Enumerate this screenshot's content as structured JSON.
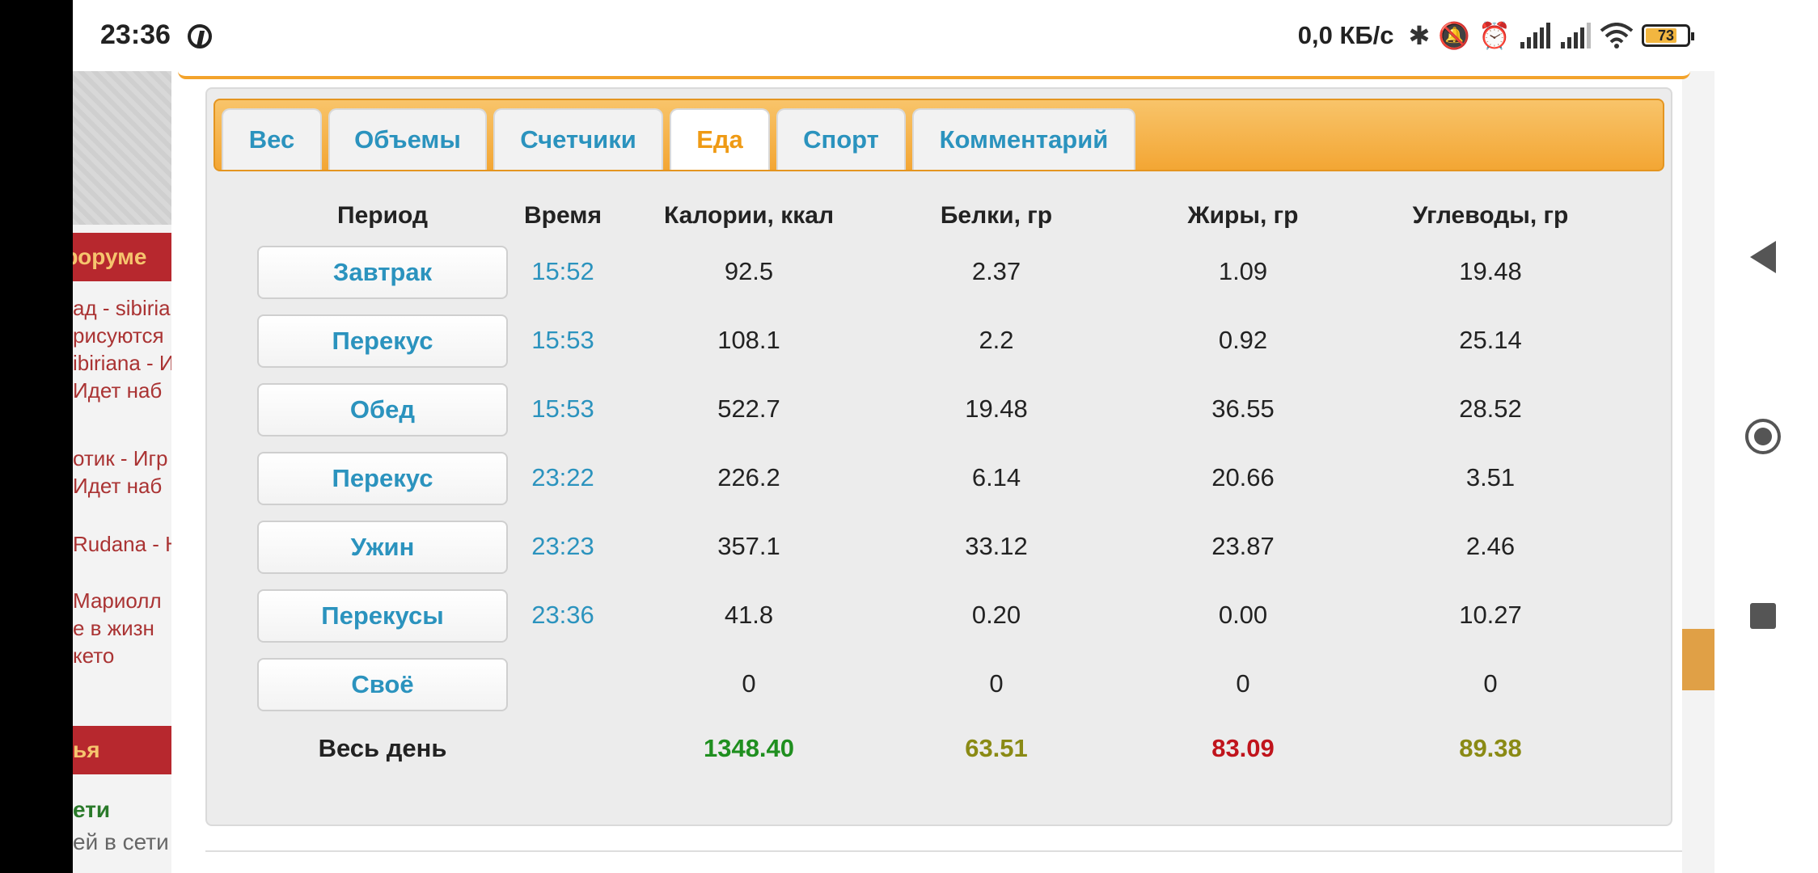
{
  "status": {
    "time": "23:36",
    "net_speed": "0,0 КБ/с",
    "battery": "73",
    "icons": [
      "pinterest-icon",
      "bluetooth-icon",
      "bell-off-icon",
      "alarm-icon",
      "signal-icon",
      "signal-icon",
      "wifi-icon",
      "battery-icon"
    ]
  },
  "background": {
    "forum_header": "форуме",
    "forum_lines": [
      "ад - sibiria",
      "рисуются",
      "ibiriana - И",
      "Идет наб",
      "отик - Игр",
      "Идет наб",
      "Rudana - Н",
      "Мариолл",
      "е в жизн",
      "кето"
    ],
    "section2_header": "ья",
    "online_label": "ети",
    "online_text": "ей в сети"
  },
  "tabs": [
    "Вес",
    "Объемы",
    "Счетчики",
    "Еда",
    "Спорт",
    "Комментарий"
  ],
  "active_tab": "Еда",
  "table": {
    "headers": [
      "Период",
      "Время",
      "Калории, ккал",
      "Белки, гр",
      "Жиры, гр",
      "Углеводы, гр"
    ],
    "rows": [
      {
        "period": "Завтрак",
        "time": "15:52",
        "kcal": "92.5",
        "protein": "2.37",
        "fat": "1.09",
        "carbs": "19.48"
      },
      {
        "period": "Перекус",
        "time": "15:53",
        "kcal": "108.1",
        "protein": "2.2",
        "fat": "0.92",
        "carbs": "25.14"
      },
      {
        "period": "Обед",
        "time": "15:53",
        "kcal": "522.7",
        "protein": "19.48",
        "fat": "36.55",
        "carbs": "28.52"
      },
      {
        "period": "Перекус",
        "time": "23:22",
        "kcal": "226.2",
        "protein": "6.14",
        "fat": "20.66",
        "carbs": "3.51"
      },
      {
        "period": "Ужин",
        "time": "23:23",
        "kcal": "357.1",
        "protein": "33.12",
        "fat": "23.87",
        "carbs": "2.46"
      },
      {
        "period": "Перекусы",
        "time": "23:36",
        "kcal": "41.8",
        "protein": "0.20",
        "fat": "0.00",
        "carbs": "10.27"
      },
      {
        "period": "Своё",
        "time": "",
        "kcal": "0",
        "protein": "0",
        "fat": "0",
        "carbs": "0"
      }
    ],
    "total": {
      "label": "Весь день",
      "kcal": "1348.40",
      "protein": "63.51",
      "fat": "83.09",
      "carbs": "89.38"
    }
  },
  "colors": {
    "accent": "#f3a634",
    "link": "#2b93be",
    "kcal_total": "#1f8f1f",
    "protein_total": "#8a8a14",
    "fat_total": "#c0141c",
    "carbs_total": "#8a8a14"
  }
}
